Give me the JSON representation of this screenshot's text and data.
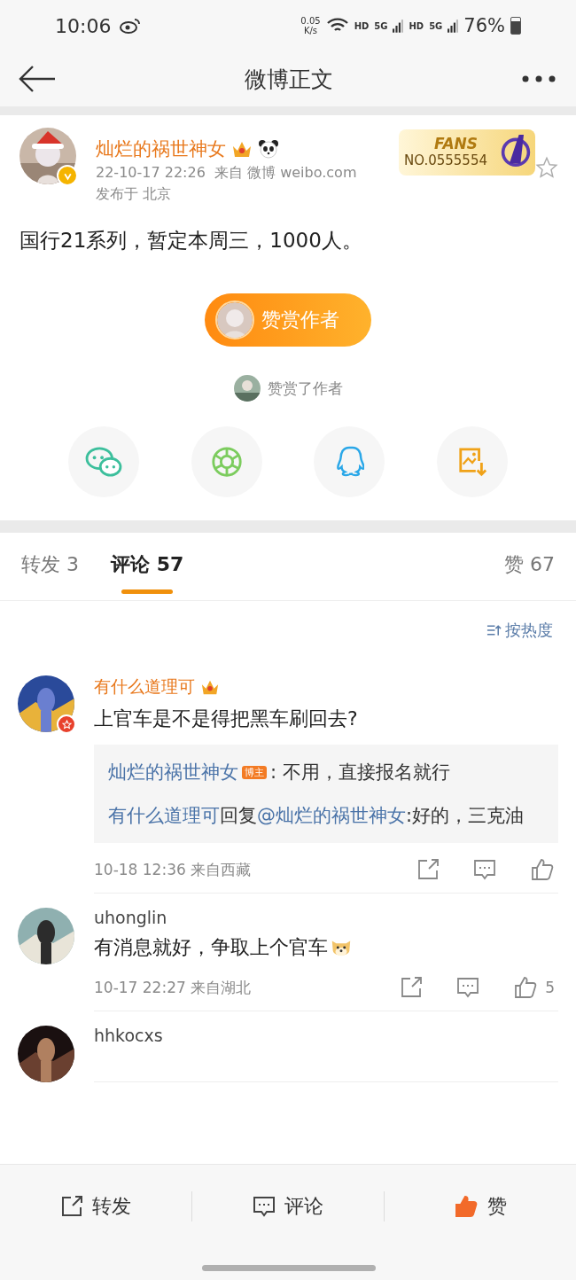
{
  "status_bar": {
    "time": "10:06",
    "speed": "0.05",
    "speed_unit": "K/s",
    "networks": [
      "HD",
      "5G",
      "HD",
      "5G"
    ],
    "battery": "76%"
  },
  "header": {
    "title": "微博正文"
  },
  "post": {
    "author": "灿烂的祸世神女",
    "vip": true,
    "panda": true,
    "verified": true,
    "fans_badge": {
      "label": "FANS",
      "number": "NO.0555554"
    },
    "starred": false,
    "time": "22-10-17 22:26",
    "source": "来自 微博 weibo.com",
    "location": "发布于 北京",
    "text": "国行21系列，暂定本周三，1000人。",
    "reward_button": "赞赏作者",
    "reward_note": "赞赏了作者",
    "share": [
      {
        "kind": "wechat"
      },
      {
        "kind": "moments"
      },
      {
        "kind": "qq"
      },
      {
        "kind": "save-image"
      }
    ]
  },
  "tabs": [
    {
      "label": "转发 3",
      "selected": false
    },
    {
      "label": "评论 57",
      "selected": true
    }
  ],
  "likes_tab": "赞 67",
  "sort": "按热度",
  "comments": [
    {
      "name": "有什么道理可",
      "vip": true,
      "verified": true,
      "text": "上官车是不是得把黑车刷回去?",
      "replies": [
        {
          "author": "灿烂的祸世神女",
          "badge": "博主",
          "text": ": 不用，直接报名就行"
        },
        {
          "author": "有什么道理可",
          "mid": "回复",
          "target": "@灿烂的祸世神女",
          "text": ":好的，三克油"
        }
      ],
      "time": "10-18 12:36",
      "location": "来自西藏"
    },
    {
      "name": "uhonglin",
      "vip": false,
      "text": "有消息就好，争取上个官车",
      "emoji": true,
      "time": "10-17 22:27",
      "location": "来自湖北",
      "likes": "5"
    },
    {
      "name": "hhkocxs",
      "vip": false
    }
  ],
  "bottom_bar": [
    {
      "kind": "repost",
      "label": "转发"
    },
    {
      "kind": "comment",
      "label": "评论"
    },
    {
      "kind": "like",
      "label": "赞",
      "liked": true
    }
  ]
}
